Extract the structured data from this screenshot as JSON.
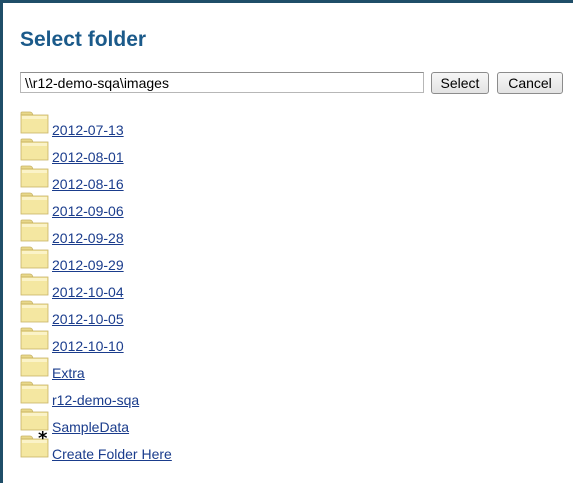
{
  "dialog": {
    "title": "Select folder",
    "path_value": "\\\\r12-demo-sqa\\images",
    "select_label": "Select",
    "cancel_label": "Cancel"
  },
  "folders": [
    {
      "label": "2012-07-13",
      "icon": "folder-icon"
    },
    {
      "label": "2012-08-01",
      "icon": "folder-icon"
    },
    {
      "label": "2012-08-16",
      "icon": "folder-icon"
    },
    {
      "label": "2012-09-06",
      "icon": "folder-icon"
    },
    {
      "label": "2012-09-28",
      "icon": "folder-icon"
    },
    {
      "label": "2012-09-29",
      "icon": "folder-icon"
    },
    {
      "label": "2012-10-04",
      "icon": "folder-icon"
    },
    {
      "label": "2012-10-05",
      "icon": "folder-icon"
    },
    {
      "label": "2012-10-10",
      "icon": "folder-icon"
    },
    {
      "label": "Extra",
      "icon": "folder-icon"
    },
    {
      "label": "r12-demo-sqa",
      "icon": "folder-icon"
    },
    {
      "label": "SampleData",
      "icon": "folder-icon"
    }
  ],
  "create_folder": {
    "label": "Create Folder Here",
    "icon": "new-folder-icon"
  },
  "colors": {
    "title": "#1b5a8a",
    "link": "#1a3c8c",
    "frame_border": "#1f4e68",
    "folder_fill": "#f4e7a1"
  }
}
